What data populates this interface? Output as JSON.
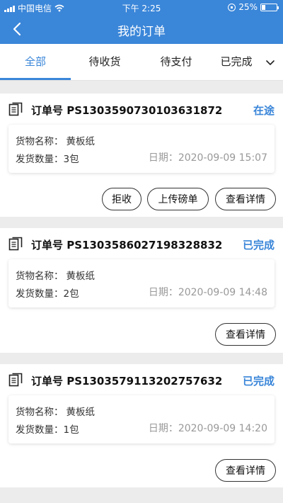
{
  "status_bar": {
    "carrier": "中国电信",
    "time": "下午 2:25",
    "battery": "25%"
  },
  "nav": {
    "title": "我的订单"
  },
  "tabs": [
    {
      "label": "全部",
      "active": true
    },
    {
      "label": "待收货",
      "active": false
    },
    {
      "label": "待支付",
      "active": false
    },
    {
      "label": "已完成",
      "active": false
    }
  ],
  "labels": {
    "order_prefix": "订单号",
    "goods_name": "货物名称：",
    "quantity": "发货数量：",
    "date": "日期："
  },
  "orders": [
    {
      "order_no": "PS1303590730103631872",
      "status": "在途",
      "goods": "黄板纸",
      "quantity": "3包",
      "date": "2020-09-09 15:07",
      "actions": [
        "拒收",
        "上传磅单",
        "查看详情"
      ]
    },
    {
      "order_no": "PS1303586027198328832",
      "status": "已完成",
      "goods": "黄板纸",
      "quantity": "2包",
      "date": "2020-09-09 14:48",
      "actions": [
        "查看详情"
      ]
    },
    {
      "order_no": "PS1303579113202757632",
      "status": "已完成",
      "goods": "黄板纸",
      "quantity": "1包",
      "date": "2020-09-09 14:20",
      "actions": [
        "查看详情"
      ]
    }
  ],
  "colors": {
    "accent": "#3a86d9",
    "background": "#ececec"
  }
}
